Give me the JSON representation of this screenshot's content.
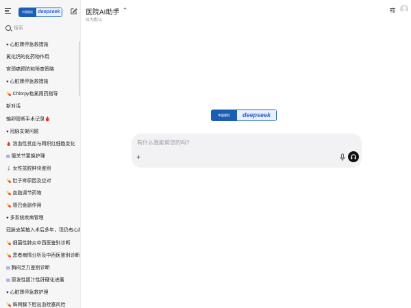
{
  "sidebar": {
    "logo": {
      "left_text": "中国版权",
      "right_text": "deepseek"
    },
    "search_placeholder": "搜索",
    "chats": [
      {
        "icon": "heart-icon",
        "glyph": "♥",
        "color": "#222222",
        "label": "心脏骤停急救措施"
      },
      {
        "icon": "",
        "glyph": "",
        "color": "#222222",
        "label": "氯化钙的化药物作用"
      },
      {
        "icon": "",
        "glyph": "",
        "color": "#222222",
        "label": "宫颈癌预防和筛查策略"
      },
      {
        "icon": "heart-icon",
        "glyph": "♥",
        "color": "#222222",
        "label": "心脏骤停急救措施"
      },
      {
        "icon": "pill-icon",
        "glyph": "💊",
        "color": "#d9534f",
        "label": "Chlorpy格氯雨药指导"
      },
      {
        "icon": "",
        "glyph": "",
        "color": "#222222",
        "label": "新对话"
      },
      {
        "icon": "",
        "glyph": "",
        "color": "#222222",
        "label": "输卵管断手术记录🩸"
      },
      {
        "icon": "heart-icon",
        "glyph": "♥",
        "color": "#222222",
        "label": "冠脉支架问题"
      },
      {
        "icon": "drop-icon",
        "glyph": "🩸",
        "color": "#c0392b",
        "label": "溶血性贫血与网织红细胞变化"
      },
      {
        "icon": "document-icon",
        "glyph": "▤",
        "color": "#6b5bd6",
        "label": "髋关节置换护理"
      },
      {
        "icon": "thermometer-icon",
        "glyph": "🌡",
        "color": "#888888",
        "label": "女性盆腔肿块鉴别"
      },
      {
        "icon": "pill-icon",
        "glyph": "💊",
        "color": "#d9534f",
        "label": "肚子疼原因及应对"
      },
      {
        "icon": "pill-icon",
        "glyph": "💊",
        "color": "#d9534f",
        "label": "血脂调节药物"
      },
      {
        "icon": "pill-icon",
        "glyph": "💊",
        "color": "#d9534f",
        "label": "德巴金副作用"
      },
      {
        "icon": "heart-icon",
        "glyph": "♥",
        "color": "#222222",
        "label": "多系统疾病管理"
      },
      {
        "icon": "",
        "glyph": "",
        "color": "#222222",
        "label": "冠脉支架植入术后多年，现仍有心绞"
      },
      {
        "icon": "pill-icon",
        "glyph": "💊",
        "color": "#d9534f",
        "label": "细菌性肺炎中西医鉴别诊断"
      },
      {
        "icon": "pill-icon",
        "glyph": "💊",
        "color": "#d9534f",
        "label": "患者病情分析及中西医鉴别诊断"
      },
      {
        "icon": "document-icon",
        "glyph": "▤",
        "color": "#6b5bd6",
        "label": "胸闷乏力鉴别诊断"
      },
      {
        "icon": "document-icon",
        "glyph": "▤",
        "color": "#6b5bd6",
        "label": "原发性胆汁性肝硬化进展"
      },
      {
        "icon": "heart-icon",
        "glyph": "♥",
        "color": "#222222",
        "label": "心脏骤停急救护理"
      },
      {
        "icon": "pill-icon",
        "glyph": "💊",
        "color": "#d9534f",
        "label": "蛛网膜下腔出血栓塞风险"
      }
    ]
  },
  "header": {
    "title": "医院AI助手",
    "chevron": "⌄",
    "add": "+",
    "subtitle": "应为默认"
  },
  "main": {
    "logo": {
      "left_text": "中国版权",
      "right_text": "deepseek"
    },
    "composer": {
      "placeholder": "有什么我能帮您的吗?",
      "plus": "+"
    }
  }
}
